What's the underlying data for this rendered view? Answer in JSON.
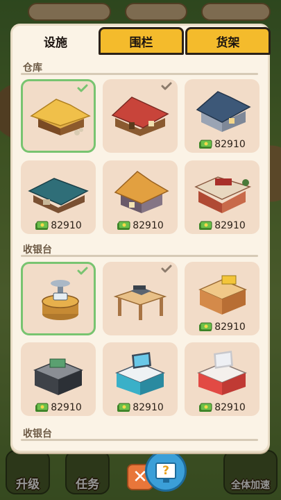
{
  "tabs": [
    {
      "label": "设施",
      "active": true
    },
    {
      "label": "围栏",
      "active": false
    },
    {
      "label": "货架",
      "active": false
    }
  ],
  "sections": [
    {
      "title": "仓库",
      "items": [
        {
          "icon": "thatched-warehouse-icon",
          "state": "selected",
          "price": ""
        },
        {
          "icon": "red-roof-warehouse-icon",
          "state": "owned",
          "price": ""
        },
        {
          "icon": "stone-warehouse-icon",
          "state": "locked",
          "price": "82910"
        },
        {
          "icon": "teal-roof-warehouse-icon",
          "state": "locked",
          "price": "82910"
        },
        {
          "icon": "orange-roof-house-icon",
          "state": "locked",
          "price": "82910"
        },
        {
          "icon": "brick-shop-warehouse-icon",
          "state": "locked",
          "price": "82910"
        }
      ]
    },
    {
      "title": "收银台",
      "items": [
        {
          "icon": "stump-scale-icon",
          "state": "selected",
          "price": ""
        },
        {
          "icon": "wooden-table-register-icon",
          "state": "owned",
          "price": ""
        },
        {
          "icon": "wooden-counter-register-icon",
          "state": "locked",
          "price": "82910"
        },
        {
          "icon": "black-counter-register-icon",
          "state": "locked",
          "price": "82910"
        },
        {
          "icon": "blue-counter-register-icon",
          "state": "locked",
          "price": "82910"
        },
        {
          "icon": "red-counter-register-icon",
          "state": "locked",
          "price": "82910"
        }
      ]
    },
    {
      "title": "收银台",
      "items": []
    }
  ],
  "bottom_bar": {
    "upgrade_label": "升级",
    "tasks_label": "任务",
    "speedup_label": "全体加速",
    "close_label": "✕",
    "help_label": "?"
  },
  "colors": {
    "tab_inactive": "#f4bb2c",
    "card_bg": "#f2dcc8",
    "selected_border": "#78c470",
    "owned_check": "#8c7b6c",
    "selected_check": "#78c470"
  }
}
